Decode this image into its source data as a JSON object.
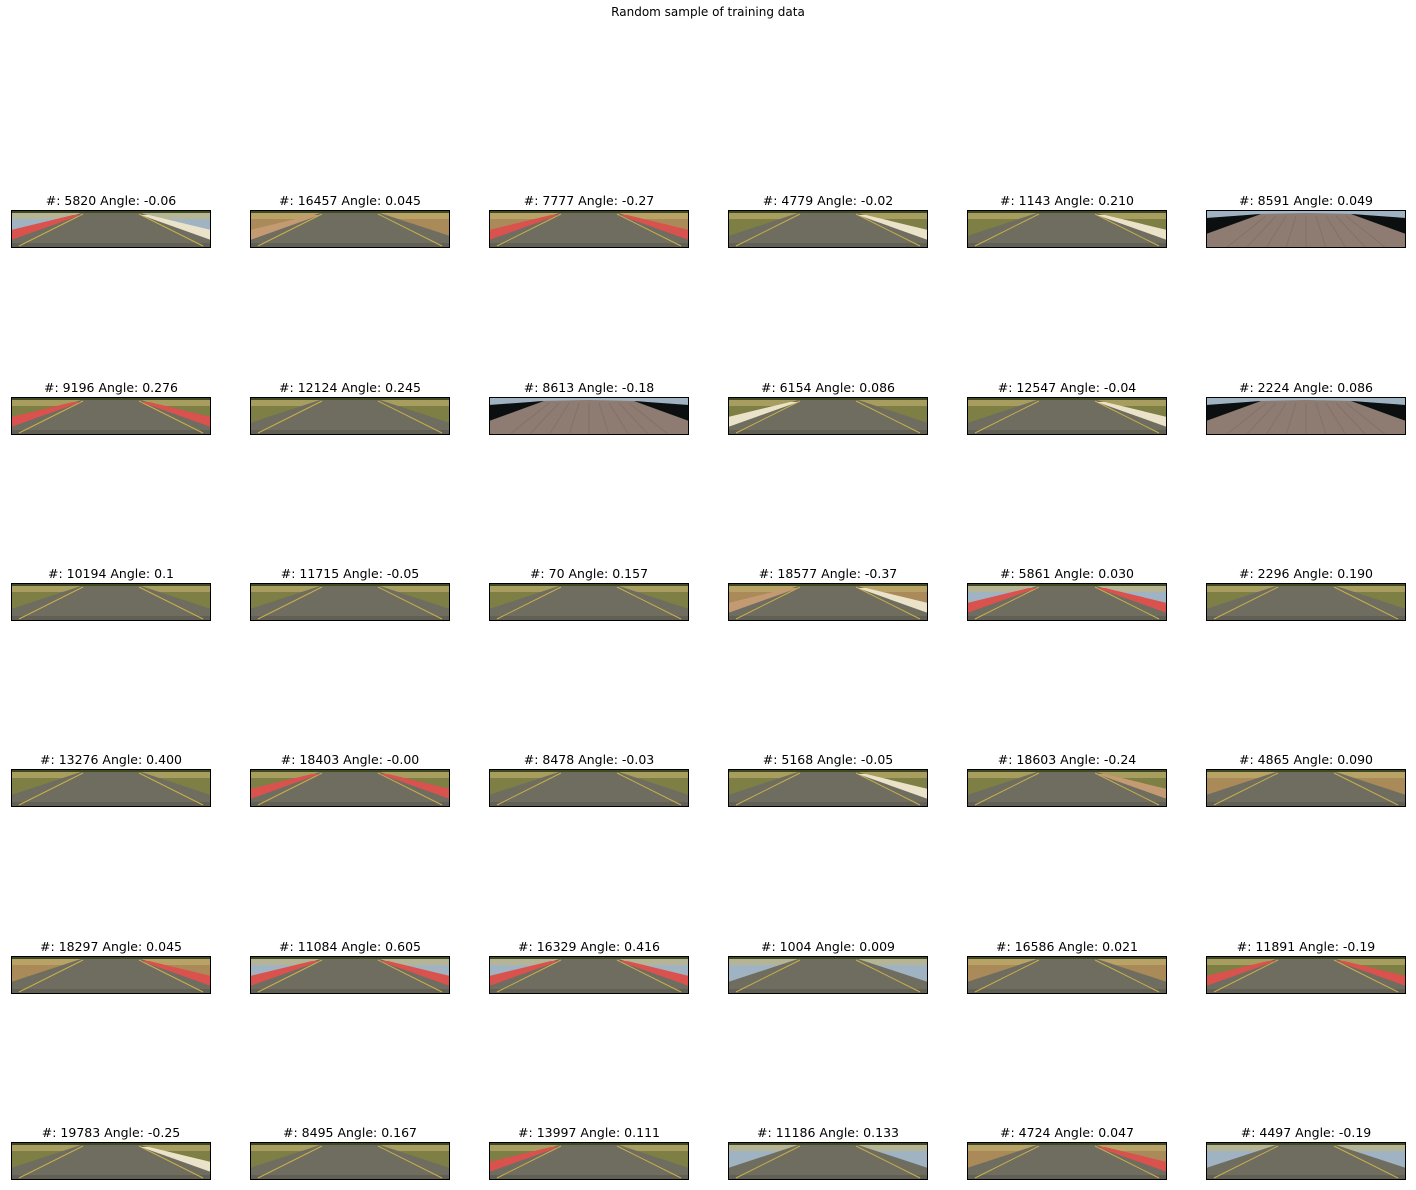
{
  "figure": {
    "title": "Random sample of training data"
  },
  "panels": [
    {
      "label": "#: 5820 Angle: -0.06",
      "scene": "lake",
      "curb_left": "red",
      "curb_right": "white"
    },
    {
      "label": "#: 16457 Angle: 0.045",
      "scene": "dirt",
      "curb_left": "tan",
      "curb_right": "none"
    },
    {
      "label": "#: 7777 Angle: -0.27",
      "scene": "dirt",
      "curb_left": "red",
      "curb_right": "red"
    },
    {
      "label": "#: 4779 Angle: -0.02",
      "scene": "grass",
      "curb_left": "none",
      "curb_right": "white"
    },
    {
      "label": "#: 1143 Angle: 0.210",
      "scene": "grass",
      "curb_left": "none",
      "curb_right": "white"
    },
    {
      "label": "#: 8591 Angle: 0.049",
      "scene": "bridge",
      "curb_left": "none",
      "curb_right": "none"
    },
    {
      "label": "#: 9196 Angle: 0.276",
      "scene": "grass",
      "curb_left": "red",
      "curb_right": "red"
    },
    {
      "label": "#: 12124 Angle: 0.245",
      "scene": "grass",
      "curb_left": "none",
      "curb_right": "none"
    },
    {
      "label": "#: 8613 Angle: -0.18",
      "scene": "bridge",
      "curb_left": "none",
      "curb_right": "none"
    },
    {
      "label": "#: 6154 Angle: 0.086",
      "scene": "grass",
      "curb_left": "white",
      "curb_right": "none"
    },
    {
      "label": "#: 12547 Angle: -0.04",
      "scene": "grass",
      "curb_left": "none",
      "curb_right": "white"
    },
    {
      "label": "#: 2224 Angle: 0.086",
      "scene": "bridge",
      "curb_left": "none",
      "curb_right": "none"
    },
    {
      "label": "#: 10194 Angle: 0.1",
      "scene": "grass",
      "curb_left": "none",
      "curb_right": "none"
    },
    {
      "label": "#: 11715 Angle: -0.05",
      "scene": "grass",
      "curb_left": "none",
      "curb_right": "none"
    },
    {
      "label": "#: 70 Angle: 0.157",
      "scene": "grass",
      "curb_left": "none",
      "curb_right": "none"
    },
    {
      "label": "#: 18577 Angle: -0.37",
      "scene": "dirt",
      "curb_left": "tan",
      "curb_right": "white"
    },
    {
      "label": "#: 5861 Angle: 0.030",
      "scene": "lake",
      "curb_left": "red",
      "curb_right": "red"
    },
    {
      "label": "#: 2296 Angle: 0.190",
      "scene": "grass",
      "curb_left": "none",
      "curb_right": "none"
    },
    {
      "label": "#: 13276 Angle: 0.400",
      "scene": "grass",
      "curb_left": "none",
      "curb_right": "none"
    },
    {
      "label": "#: 18403 Angle: -0.00",
      "scene": "grass",
      "curb_left": "red",
      "curb_right": "red"
    },
    {
      "label": "#: 8478 Angle: -0.03",
      "scene": "grass",
      "curb_left": "none",
      "curb_right": "none"
    },
    {
      "label": "#: 5168 Angle: -0.05",
      "scene": "grass",
      "curb_left": "none",
      "curb_right": "white"
    },
    {
      "label": "#: 18603 Angle: -0.24",
      "scene": "grass",
      "curb_left": "none",
      "curb_right": "tan"
    },
    {
      "label": "#: 4865 Angle: 0.090",
      "scene": "dirt",
      "curb_left": "none",
      "curb_right": "none"
    },
    {
      "label": "#: 18297 Angle: 0.045",
      "scene": "dirt",
      "curb_left": "none",
      "curb_right": "red"
    },
    {
      "label": "#: 11084 Angle: 0.605",
      "scene": "lake",
      "curb_left": "red",
      "curb_right": "red"
    },
    {
      "label": "#: 16329 Angle: 0.416",
      "scene": "lake",
      "curb_left": "red",
      "curb_right": "red"
    },
    {
      "label": "#: 1004 Angle: 0.009",
      "scene": "lake",
      "curb_left": "none",
      "curb_right": "none"
    },
    {
      "label": "#: 16586 Angle: 0.021",
      "scene": "dirt",
      "curb_left": "none",
      "curb_right": "none"
    },
    {
      "label": "#: 11891 Angle: -0.19",
      "scene": "grass",
      "curb_left": "red",
      "curb_right": "red"
    },
    {
      "label": "#: 19783 Angle: -0.25",
      "scene": "grass",
      "curb_left": "none",
      "curb_right": "white"
    },
    {
      "label": "#: 8495 Angle: 0.167",
      "scene": "grass",
      "curb_left": "none",
      "curb_right": "none"
    },
    {
      "label": "#: 13997 Angle: 0.111",
      "scene": "grass",
      "curb_left": "red",
      "curb_right": "none"
    },
    {
      "label": "#: 11186 Angle: 0.133",
      "scene": "lake",
      "curb_left": "none",
      "curb_right": "none"
    },
    {
      "label": "#: 4724 Angle: 0.047",
      "scene": "dirt",
      "curb_left": "none",
      "curb_right": "red"
    },
    {
      "label": "#: 4497 Angle: -0.19",
      "scene": "lake",
      "curb_left": "none",
      "curb_right": "none"
    }
  ],
  "colors": {
    "road": "#6f6d60",
    "road_dark": "#55544a",
    "grass": "#7e7f45",
    "grass_light": "#c7b673",
    "dirt": "#a98a58",
    "lake": "#9fb3c2",
    "bridge_shadow": "#0c0f10",
    "bridge_road": "#8e7c72",
    "curb_red": "#d9524e",
    "curb_white": "#ebe3c9",
    "curb_tan": "#c49a72",
    "lane_yellow": "#c9b04a",
    "frame": "#000000"
  }
}
